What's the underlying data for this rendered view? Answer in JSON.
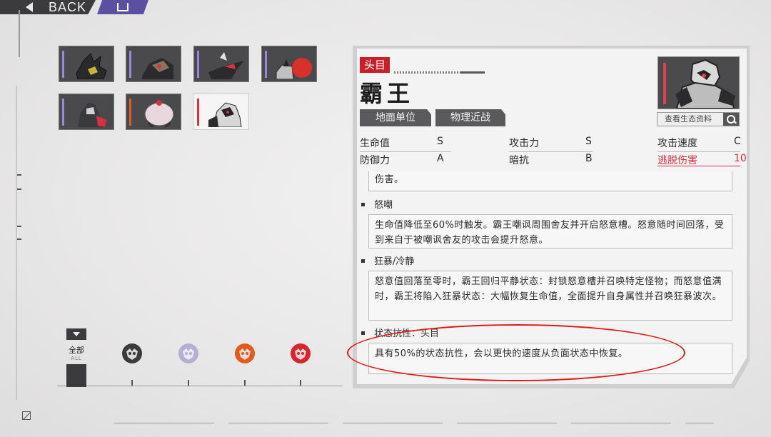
{
  "topbar": {
    "back_label": "BACK"
  },
  "roster": {
    "cards": [
      {
        "id": "enemy-1",
        "selected": false
      },
      {
        "id": "enemy-2",
        "selected": false
      },
      {
        "id": "enemy-3",
        "selected": false
      },
      {
        "id": "enemy-4",
        "selected": false
      },
      {
        "id": "enemy-5",
        "selected": false
      },
      {
        "id": "enemy-6",
        "selected": false
      },
      {
        "id": "enemy-7",
        "selected": true
      }
    ]
  },
  "filters": {
    "all_label": "全部",
    "all_sub": "ALL",
    "icons": [
      {
        "name": "faction-dark-icon",
        "color": "#3a3a3c"
      },
      {
        "name": "faction-lavender-icon",
        "color": "#b7aed6"
      },
      {
        "name": "faction-orange-icon",
        "color": "#e25a1e"
      },
      {
        "name": "faction-red-icon",
        "color": "#d8242c"
      }
    ]
  },
  "detail": {
    "rank": "头目",
    "name": "霸王",
    "chips": [
      "地面单位",
      "物理近战"
    ],
    "view_profile": "查看生态资料",
    "stats": [
      {
        "label": "生命值",
        "value": "S"
      },
      {
        "label": "攻击力",
        "value": "S"
      },
      {
        "label": "攻击速度",
        "value": "C"
      },
      {
        "label": "防御力",
        "value": "A"
      },
      {
        "label": "暗抗",
        "value": "B"
      },
      {
        "label": "逃脱伤害",
        "value": "10"
      }
    ],
    "highlight_color": "#d83040",
    "cut_text": "伤害。",
    "sections": [
      {
        "title": "怒嘲",
        "body": "生命值降低至60%时触发。霸王嘲讽周围舍友并开启怒意槽。怒意随时间回落，受到来自于被嘲讽舍友的攻击会提升怒意。"
      },
      {
        "title": "狂暴/冷静",
        "body": "怒意值回落至零时，霸王回归平静状态：封锁怒意槽并召唤特定怪物；而怒意值满时，霸王将陷入狂暴状态：大幅恢复生命值，全面提升自身属性并召唤狂暴波次。"
      },
      {
        "title": "状态抗性：头目",
        "body": "具有50%的状态抗性，会以更快的速度从负面状态中恢复。"
      }
    ]
  },
  "annotation_color": "#e01818"
}
